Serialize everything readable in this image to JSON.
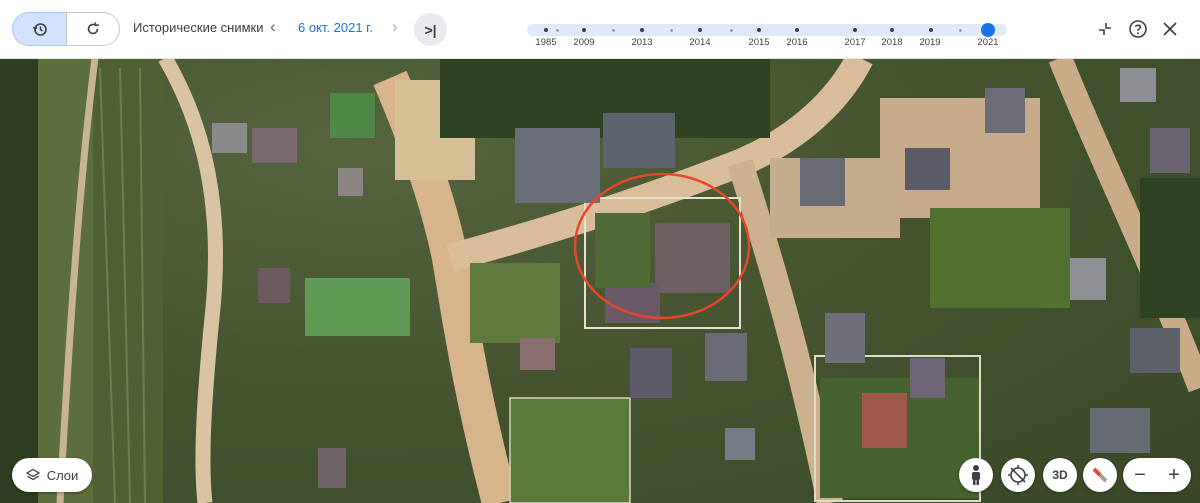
{
  "header": {
    "mode_buttons": [
      {
        "icon": "history-icon",
        "active": true
      },
      {
        "icon": "refresh-icon",
        "active": false
      }
    ],
    "title": "Исторические снимки",
    "selected_date": "6 окт. 2021 г.",
    "timeline": {
      "years": [
        "1985",
        "2009",
        "2013",
        "2014",
        "2015",
        "2016",
        "2017",
        "2018",
        "2019",
        "2021"
      ],
      "selected_year": "2021"
    },
    "icons": {
      "collapse": "collapse-icon",
      "help": "help-icon",
      "close": "close-icon"
    }
  },
  "map": {
    "type": "satellite",
    "highlight_marker": {
      "shape": "circle",
      "color": "#e8472c"
    }
  },
  "controls": {
    "layers_label": "Слои",
    "pegman": "pegman-icon",
    "compass_reset": "compass-off-icon",
    "view_3d_label": "3D",
    "compass": "compass-icon",
    "zoom_out": "−",
    "zoom_in": "+"
  },
  "colors": {
    "accent": "#1a73e8",
    "marker": "#e8472c"
  }
}
